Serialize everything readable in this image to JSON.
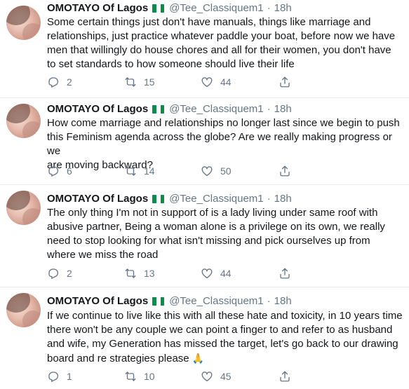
{
  "author": {
    "name": "OMOTAYO Of Lagos",
    "handle": "@Tee_Classiquem1",
    "separator": "·",
    "flag_colors": [
      "#0a8f4a",
      "#ffffff",
      "#0a8f4a"
    ]
  },
  "icons": {
    "reply": "reply-icon",
    "retweet": "retweet-icon",
    "like": "heart-icon",
    "share": "share-icon"
  },
  "colors": {
    "text": "#14171a",
    "muted": "#657786",
    "divider": "#e6ecf0"
  },
  "tweets": [
    {
      "time": "18h",
      "lines": [
        "Some certain things just don't have manuals, things like marriage and",
        "relationships, just practice whatever paddle your boat, before now we have",
        "men that willingly do house chores and all for their women, you don't have",
        "to set standards to how someone should live their life"
      ],
      "replies": "2",
      "retweets": "15",
      "likes": "44"
    },
    {
      "time": "18h",
      "lines": [
        "How come marriage and relationships no longer last since we begin to push",
        "this Feminism agenda across the globe? Are we really making progress or we",
        "are moving backward?"
      ],
      "replies": "6",
      "retweets": "14",
      "likes": "50"
    },
    {
      "time": "18h",
      "lines": [
        "The only thing I'm not in support of is a lady living under same roof with",
        "abusive partner, Being a woman alone is a privilege on its own, we really",
        "need to stop looking for what isn't missing and pick ourselves up from",
        "where we miss the road"
      ],
      "replies": "2",
      "retweets": "13",
      "likes": "44"
    },
    {
      "time": "18h",
      "lines": [
        "If we continue to live like this with all these hate and toxicity, in 10 years time",
        "there won't be any couple we can point a finger to and refer to as husband",
        "and wife, my Generation has missed the target, let's go back to our drawing",
        "board and re strategies please"
      ],
      "emoji": "🙏",
      "replies": "1",
      "retweets": "10",
      "likes": "45"
    }
  ]
}
